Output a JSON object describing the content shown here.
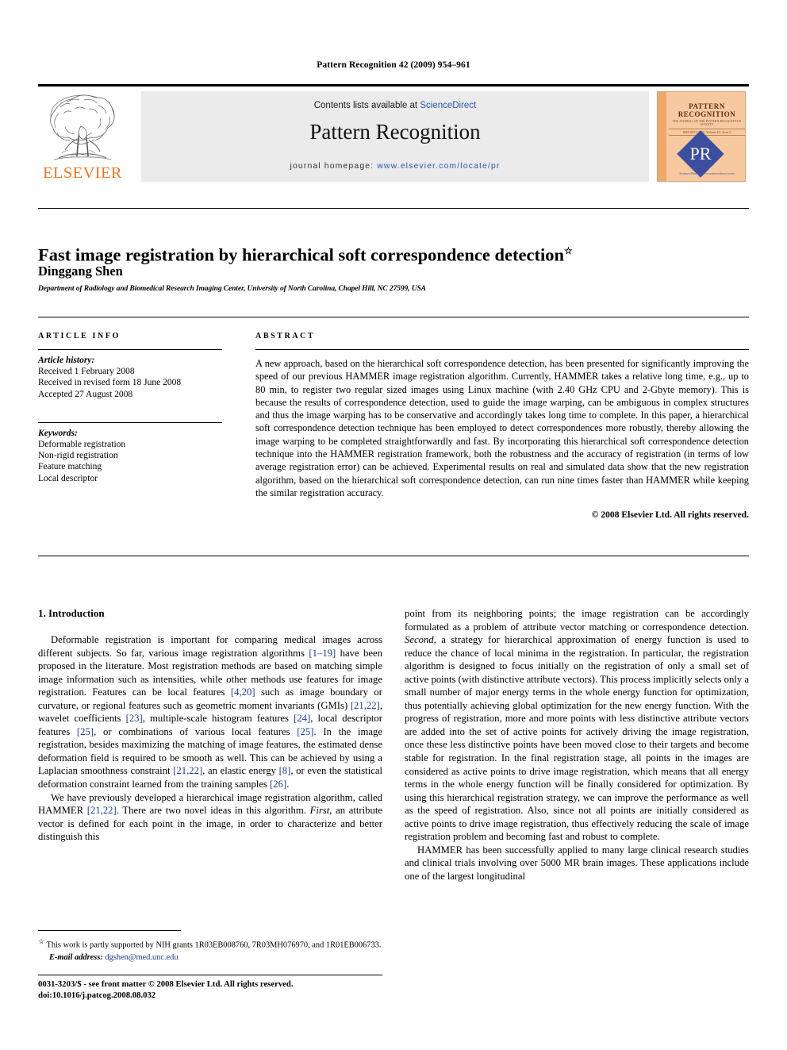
{
  "running_head": "Pattern Recognition 42 (2009) 954–961",
  "masthead": {
    "publisher_name": "ELSEVIER",
    "contents_prefix": "Contents lists available at ",
    "sciencedirect": "ScienceDirect",
    "journal_title": "Pattern Recognition",
    "homepage_label": "journal homepage: ",
    "homepage_url": "www.elsevier.com/locate/pr",
    "cover": {
      "title": "PATTERN RECOGNITION",
      "subtitle": "THE JOURNAL OF THE PATTERN RECOGNITION SOCIETY",
      "issue_line": "ISSN 0031-3203 | Volume 42 | Issue 5",
      "monogram": "PR",
      "sciencedirect_mark": "ScienceDirect www.sciencedirect.com"
    },
    "colors": {
      "link": "#2b56b0",
      "elsevier_orange": "#E87722",
      "box_gray": "#ebebeb",
      "cover_bg": "#f6c9a0",
      "cover_diamond": "#3b4f9e"
    }
  },
  "article": {
    "title": "Fast image registration by hierarchical soft correspondence detection",
    "title_marker": "☆",
    "author": "Dinggang Shen",
    "affiliation": "Department of Radiology and Biomedical Research Imaging Center, University of North Carolina, Chapel Hill, NC 27599, USA"
  },
  "info": {
    "heading": "ARTICLE INFO",
    "history_label": "Article history:",
    "history": [
      "Received 1 February 2008",
      "Received in revised form 18 June 2008",
      "Accepted 27 August 2008"
    ],
    "keywords_label": "Keywords:",
    "keywords": [
      "Deformable registration",
      "Non-rigid registration",
      "Feature matching",
      "Local descriptor"
    ]
  },
  "abstract": {
    "heading": "ABSTRACT",
    "text": "A new approach, based on the hierarchical soft correspondence detection, has been presented for significantly improving the speed of our previous HAMMER image registration algorithm. Currently, HAMMER takes a relative long time, e.g., up to 80 min, to register two regular sized images using Linux machine (with 2.40 GHz CPU and 2-Gbyte memory). This is because the results of correspondence detection, used to guide the image warping, can be ambiguous in complex structures and thus the image warping has to be conservative and accordingly takes long time to complete. In this paper, a hierarchical soft correspondence detection technique has been employed to detect correspondences more robustly, thereby allowing the image warping to be completed straightforwardly and fast. By incorporating this hierarchical soft correspondence detection technique into the HAMMER registration framework, both the robustness and the accuracy of registration (in terms of low average registration error) can be achieved. Experimental results on real and simulated data show that the new registration algorithm, based on the hierarchical soft correspondence detection, can run nine times faster than HAMMER while keeping the similar registration accuracy.",
    "copyright": "© 2008 Elsevier Ltd. All rights reserved."
  },
  "body": {
    "section_number_title": "1. Introduction",
    "left_paragraphs": [
      {
        "parts": [
          {
            "t": "Deformable registration is important for comparing medical images across different subjects. So far, various image registration algorithms "
          },
          {
            "t": "[1–19]",
            "cite": true
          },
          {
            "t": " have been proposed in the literature. Most registration methods are based on matching simple image information such as intensities, while other methods use features for image registration. Features can be local features "
          },
          {
            "t": "[4,20]",
            "cite": true
          },
          {
            "t": " such as image boundary or curvature, or regional features such as geometric moment invariants (GMIs) "
          },
          {
            "t": "[21,22]",
            "cite": true
          },
          {
            "t": ", wavelet coefficients "
          },
          {
            "t": "[23]",
            "cite": true
          },
          {
            "t": ", multiple-scale histogram features "
          },
          {
            "t": "[24]",
            "cite": true
          },
          {
            "t": ", local descriptor features "
          },
          {
            "t": "[25]",
            "cite": true
          },
          {
            "t": ", or combinations of various local features "
          },
          {
            "t": "[25]",
            "cite": true
          },
          {
            "t": ". In the image registration, besides maximizing the matching of image features, the estimated dense deformation field is required to be smooth as well. This can be achieved by using a Laplacian smoothness constraint "
          },
          {
            "t": "[21,22]",
            "cite": true
          },
          {
            "t": ", an elastic energy "
          },
          {
            "t": "[8]",
            "cite": true
          },
          {
            "t": ", or even the statistical deformation constraint learned from the training samples "
          },
          {
            "t": "[26]",
            "cite": true
          },
          {
            "t": "."
          }
        ]
      },
      {
        "parts": [
          {
            "t": "We have previously developed a hierarchical image registration algorithm, called HAMMER "
          },
          {
            "t": "[21,22]",
            "cite": true
          },
          {
            "t": ". There are two novel ideas in this algorithm. "
          },
          {
            "t": "First",
            "ital": true
          },
          {
            "t": ", an attribute vector is defined for each point in the image, in order to characterize and better distinguish this"
          }
        ]
      }
    ],
    "right_paragraphs": [
      {
        "continued": true,
        "parts": [
          {
            "t": "point from its neighboring points; the image registration can be accordingly formulated as a problem of attribute vector matching or correspondence detection. "
          },
          {
            "t": "Second",
            "ital": true
          },
          {
            "t": ", a strategy for hierarchical approximation of energy function is used to reduce the chance of local minima in the registration. In particular, the registration algorithm is designed to focus initially on the registration of only a small set of active points (with distinctive attribute vectors). This process implicitly selects only a small number of major energy terms in the whole energy function for optimization, thus potentially achieving global optimization for the new energy function. With the progress of registration, more and more points with less distinctive attribute vectors are added into the set of active points for actively driving the image registration, once these less distinctive points have been moved close to their targets and become stable for registration. In the final registration stage, all points in the images are considered as active points to drive image registration, which means that all energy terms in the whole energy function will be finally considered for optimization. By using this hierarchical registration strategy, we can improve the performance as well as the speed of registration. Also, since not all points are initially considered as active points to drive image registration, thus effectively reducing the scale of image registration problem and becoming fast and robust to complete."
          }
        ]
      },
      {
        "parts": [
          {
            "t": "HAMMER has been successfully applied to many large clinical research studies and clinical trials involving over 5000 MR brain images. These applications include one of the largest longitudinal"
          }
        ]
      }
    ]
  },
  "footnote": {
    "marker": "☆",
    "text": "This work is partly supported by NIH grants 1R03EB008760, 7R03MH076970, and 1R01EB006733.",
    "email_label": "E-mail address:",
    "email": "dgshen@med.unc.edu"
  },
  "footer": {
    "line1": "0031-3203/$ - see front matter © 2008 Elsevier Ltd. All rights reserved.",
    "line2": "doi:10.1016/j.patcog.2008.08.032"
  }
}
